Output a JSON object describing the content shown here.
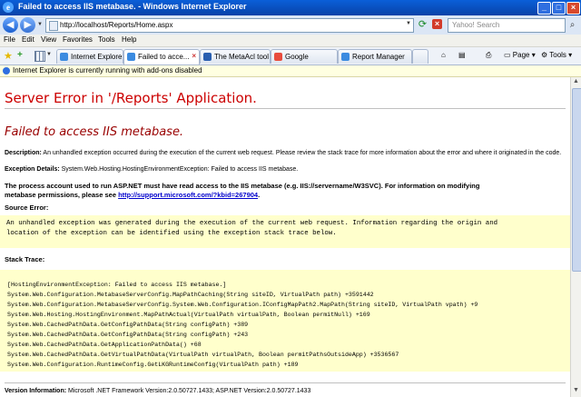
{
  "window": {
    "title": "Failed to access IIS metabase. - Windows Internet Explorer",
    "min_glyph": "_",
    "max_glyph": "□",
    "close_glyph": "×"
  },
  "address_bar": {
    "url": "http://localhost/Reports/Home.aspx",
    "search_placeholder": "Yahoo! Search"
  },
  "menu": [
    "File",
    "Edit",
    "View",
    "Favorites",
    "Tools",
    "Help"
  ],
  "tabs": [
    {
      "label": "Internet Explorer...",
      "color": "#3b8be0",
      "active": false
    },
    {
      "label": "Failed to acce...",
      "color": "#3b8be0",
      "active": true
    },
    {
      "label": "The MetaAcl tool ...",
      "color": "#2a5fb0",
      "active": false
    },
    {
      "label": "Google",
      "color": "#e84c3d",
      "active": false
    },
    {
      "label": "Report Manager",
      "color": "#3b8be0",
      "active": false
    }
  ],
  "toolbar": {
    "page_label": "Page",
    "tools_label": "Tools"
  },
  "infobar": {
    "text": "Internet Explorer is currently running with add-ons disabled"
  },
  "content": {
    "server_error": "Server Error in '/Reports' Application.",
    "error_title": "Failed to access IIS metabase.",
    "description_label": "Description:",
    "description_text": "An unhandled exception occurred during the execution of the current web request. Please review the stack trace for more information about the error and where it originated in the code.",
    "exception_label": "Exception Details:",
    "exception_text": "System.Web.Hosting.HostingEnvironmentException: Failed to access IIS metabase.",
    "process_text_1": "The process account used to run ASP.NET must have read access to the IIS metabase (e.g. IIS://servername/W3SVC). For information on modifying",
    "process_text_2": "metabase permissions, please see",
    "process_link": "http://support.microsoft.com/?kbid=267904",
    "process_end": ".",
    "source_error_label": "Source Error:",
    "source_error_line1": "An unhandled exception was generated during the execution of the current web request. Information regarding the origin and",
    "source_error_line2": "location of the exception can be identified using the exception stack trace below.",
    "stack_trace_label": "Stack Trace:",
    "stack_lines": [
      "[HostingEnvironmentException: Failed to access IIS metabase.]",
      "   System.Web.Configuration.MetabaseServerConfig.MapPathCaching(String siteID, VirtualPath path) +3591442",
      "   System.Web.Configuration.MetabaseServerConfig.System.Web.Configuration.IConfigMapPath2.MapPath(String siteID, VirtualPath vpath) +9",
      "   System.Web.Hosting.HostingEnvironment.MapPathActual(VirtualPath virtualPath, Boolean permitNull) +169",
      "   System.Web.CachedPathData.GetConfigPathData(String configPath) +389",
      "   System.Web.CachedPathData.GetConfigPathData(String configPath) +243",
      "   System.Web.CachedPathData.GetApplicationPathData() +68",
      "   System.Web.CachedPathData.GetVirtualPathData(VirtualPath virtualPath, Boolean permitPathsOutsideApp) +3536567",
      "   System.Web.Configuration.RuntimeConfig.GetLKGRuntimeConfig(VirtualPath path) +189"
    ],
    "version_label": "Version Information:",
    "version_text": "Microsoft .NET Framework Version:2.0.50727.1433; ASP.NET Version:2.0.50727.1433"
  }
}
